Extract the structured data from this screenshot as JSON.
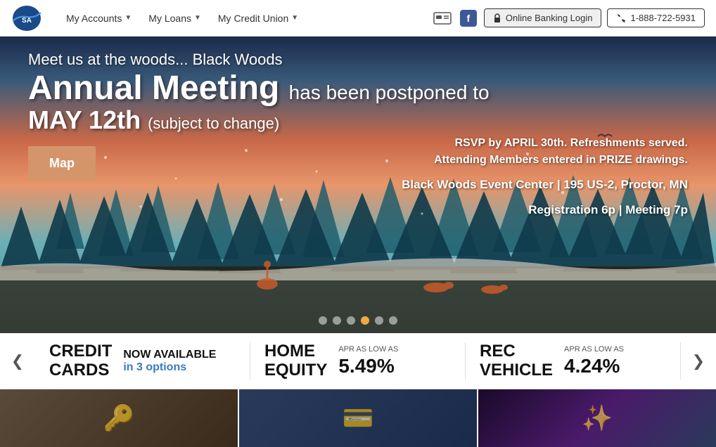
{
  "header": {
    "logo_alt": "Share Advantage Credit Union",
    "nav": [
      {
        "label": "My Accounts",
        "has_dropdown": true
      },
      {
        "label": "My Loans",
        "has_dropdown": true
      },
      {
        "label": "My Credit Union",
        "has_dropdown": true
      }
    ],
    "online_banking_label": "Online Banking Login",
    "phone_label": "1-888-722-5931"
  },
  "hero": {
    "line1": "Meet us at the woods... Black Woods",
    "line2_main": "Annual Meeting",
    "line2_sub": "has been postponed to",
    "line3_main": "MAY 12th",
    "line3_sub": "(subject to change)",
    "map_button": "Map",
    "rsvp_line1": "RSVP by APRIL 30th. Refreshments served.",
    "rsvp_line2": "Attending Members entered in PRIZE drawings.",
    "venue_line1": "Black Woods Event Center | 195 US-2, Proctor, MN",
    "venue_line2": "Registration 6p  |  Meeting 7p"
  },
  "carousel": {
    "dots": [
      1,
      2,
      3,
      4,
      5,
      6
    ],
    "active_dot": 4
  },
  "promo_bar": {
    "left_arrow": "❮",
    "right_arrow": "❯",
    "sections": [
      {
        "title": "CREDIT\nCARDS",
        "now_label": "NOW AVAILABLE",
        "sub_label": "in 3 options",
        "type": "text"
      },
      {
        "title": "HOME\nEQUITY",
        "small_label": "APR AS LOW AS",
        "rate": "5.49%",
        "type": "rate"
      },
      {
        "title": "REC\nVEHICLE",
        "small_label": "APR AS LOW AS",
        "rate": "4.24%",
        "type": "rate"
      }
    ]
  }
}
